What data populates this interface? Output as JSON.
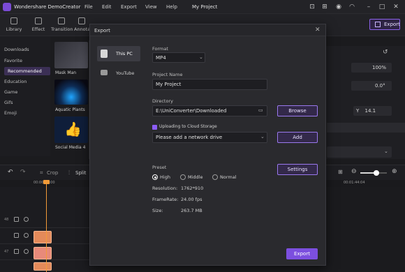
{
  "app": {
    "title": "Wondershare DemoCreator",
    "project": "My Project"
  },
  "menu": [
    "File",
    "Edit",
    "Export",
    "View",
    "Help"
  ],
  "toolbar": {
    "tools": [
      "Library",
      "Effect",
      "Transition",
      "Annotation"
    ],
    "export_label": "Export"
  },
  "categories": [
    "Downloads",
    "Favorite",
    "Recommended",
    "Education",
    "Game",
    "Gifs",
    "Emoji"
  ],
  "active_category": "Recommended",
  "thumbnails": [
    "Mask Man",
    "Aquatic Plants",
    "Social Media 4"
  ],
  "properties": {
    "scale": "100%",
    "rotation": "0.0°",
    "y_label": "Y",
    "y_value": "14.1"
  },
  "timeline": {
    "crop_label": "Crop",
    "split_label": "Split",
    "start_time": "00:00:00:00",
    "end_time": "00:01:44:04",
    "tracks": [
      "48",
      "47"
    ]
  },
  "dialog": {
    "title": "Export",
    "targets": [
      "This PC",
      "YouTube"
    ],
    "active_target": "This PC",
    "format_label": "Format",
    "format_value": "MP4",
    "project_name_label": "Project Name",
    "project_name_value": "My Project",
    "directory_label": "Directory",
    "directory_value": "E:\\UniConverter\\Downloaded",
    "browse_label": "Browse",
    "cloud_label": "Uploading to Cloud Storage",
    "cloud_drive_placeholder": "Please add a network drive",
    "add_label": "Add",
    "preset_label": "Preset",
    "settings_label": "Settings",
    "quality_options": [
      "High",
      "Middle",
      "Normal"
    ],
    "quality_selected": "High",
    "resolution_label": "Resolution:",
    "resolution_value": "1762*910",
    "framerate_label": "FrameRate:",
    "framerate_value": "24.00 fps",
    "size_label": "Size:",
    "size_value": "263.7 MB",
    "export_label": "Export"
  },
  "colors": {
    "accent": "#7c4fdf",
    "playhead": "#f29b38",
    "clip": "#e48a5a"
  }
}
